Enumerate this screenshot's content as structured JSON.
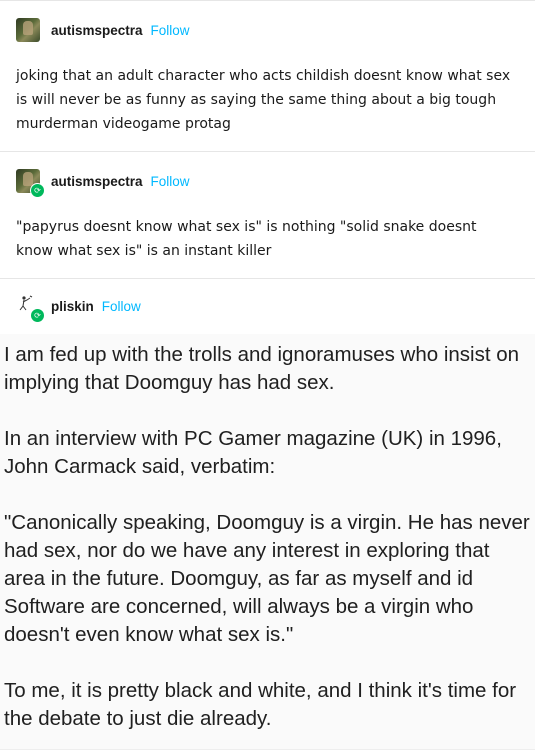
{
  "posts": [
    {
      "username": "autismspectra",
      "follow_label": "Follow",
      "text": "joking that an adult character who acts childish doesnt know what sex is will never be as funny as saying the same thing about a big tough murderman videogame protag"
    },
    {
      "username": "autismspectra",
      "follow_label": "Follow",
      "text": "\"papyrus doesnt know what sex is\" is nothing \"solid snake doesnt know what sex is\" is an instant killer"
    },
    {
      "username": "pliskin",
      "follow_label": "Follow",
      "screenshot_paragraphs": [
        "I am fed up with the trolls and ignoramuses who insist on implying that Doomguy has had sex.",
        "In an interview with PC Gamer magazine (UK) in 1996, John Carmack said, verbatim:",
        "\"Canonically speaking, Doomguy is a virgin. He has never had sex, nor do we have any interest in exploring that area in the future. Doomguy, as far as myself and id Software are concerned, will always be a virgin who doesn't even know what sex is.\"",
        "To me, it is pretty black and white, and I think it's time for the debate to just die already."
      ]
    }
  ],
  "icons": {
    "reblog_badge": "reblog-icon",
    "avatar_1": "avatar-autismspectra",
    "avatar_3": "avatar-pliskin"
  },
  "colors": {
    "follow": "#00b8ff",
    "reblog_badge": "#00b85c",
    "divider": "#e6e6e6"
  }
}
